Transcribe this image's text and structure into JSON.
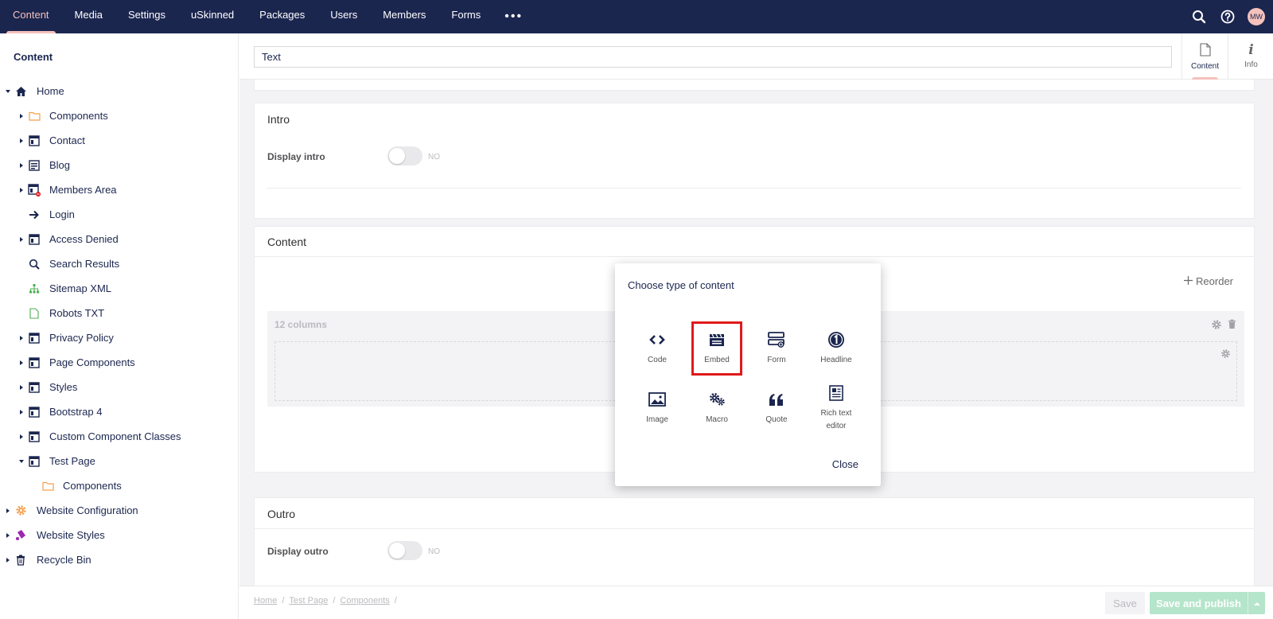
{
  "nav": {
    "items": [
      "Content",
      "Media",
      "Settings",
      "uSkinned",
      "Packages",
      "Users",
      "Members",
      "Forms"
    ],
    "more": "•••",
    "avatar_initials": "MW",
    "active": "Content",
    "accent_color": "#1b264f"
  },
  "sidebar": {
    "title": "Content",
    "tree": [
      {
        "label": "Home",
        "icon": "home-icon"
      },
      {
        "label": "Components",
        "icon": "folder-icon"
      },
      {
        "label": "Contact",
        "icon": "page-icon"
      },
      {
        "label": "Blog",
        "icon": "blog-icon"
      },
      {
        "label": "Members Area",
        "icon": "members-page-icon"
      },
      {
        "label": "Login",
        "icon": "arrow-right-icon"
      },
      {
        "label": "Access Denied",
        "icon": "page-icon"
      },
      {
        "label": "Search Results",
        "icon": "search-icon"
      },
      {
        "label": "Sitemap XML",
        "icon": "sitemap-icon"
      },
      {
        "label": "Robots TXT",
        "icon": "document-icon"
      },
      {
        "label": "Privacy Policy",
        "icon": "page-icon"
      },
      {
        "label": "Page Components",
        "icon": "page-icon"
      },
      {
        "label": "Styles",
        "icon": "page-icon"
      },
      {
        "label": "Bootstrap 4",
        "icon": "page-icon"
      },
      {
        "label": "Custom Component Classes",
        "icon": "page-icon"
      },
      {
        "label": "Test Page",
        "icon": "page-icon"
      },
      {
        "label": "Components",
        "icon": "folder-icon"
      },
      {
        "label": "Website Configuration",
        "icon": "gear-icon"
      },
      {
        "label": "Website Styles",
        "icon": "paint-icon"
      },
      {
        "label": "Recycle Bin",
        "icon": "trash-icon"
      }
    ]
  },
  "editor": {
    "name_value": "Text",
    "apps": [
      {
        "label": "Content",
        "icon": "document-icon"
      },
      {
        "label": "Info",
        "icon": "info-icon"
      }
    ],
    "intro": {
      "title": "Intro",
      "prop_label": "Display intro",
      "toggle_text": "NO"
    },
    "content": {
      "title": "Content",
      "reorder": "Reorder",
      "row_label": "12 columns"
    },
    "outro": {
      "title": "Outro",
      "prop_label": "Display outro",
      "toggle_text": "NO"
    }
  },
  "footer": {
    "breadcrumbs": [
      "Home",
      "Test Page",
      "Components"
    ],
    "separator": "/",
    "save": "Save",
    "save_publish": "Save and publish"
  },
  "dialog": {
    "title": "Choose type of content",
    "options": [
      {
        "label": "Code",
        "icon": "code-icon"
      },
      {
        "label": "Embed",
        "icon": "embed-icon",
        "selected": true
      },
      {
        "label": "Form",
        "icon": "form-icon"
      },
      {
        "label": "Headline",
        "icon": "headline-icon"
      },
      {
        "label": "Image",
        "icon": "image-icon"
      },
      {
        "label": "Macro",
        "icon": "macro-icon"
      },
      {
        "label": "Quote",
        "icon": "quote-icon"
      },
      {
        "label": "Rich text editor",
        "icon": "rich-text-icon"
      }
    ],
    "close": "Close"
  }
}
